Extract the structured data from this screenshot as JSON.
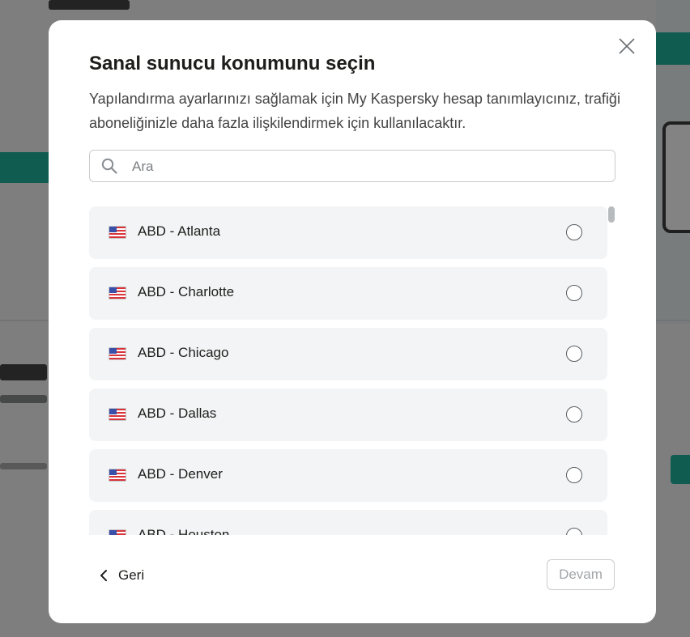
{
  "dialog": {
    "title": "Sanal sunucu konumunu seçin",
    "subtitle": "Yapılandırma ayarlarınızı sağlamak için My Kaspersky hesap tanımlayıcınız, trafiği aboneliğinizle daha fazla ilişkilendirmek için kullanılacaktır.",
    "close_icon": "close-icon"
  },
  "search": {
    "placeholder": "Ara",
    "value": "",
    "icon": "search-icon"
  },
  "locations": [
    {
      "label": "ABD - Atlanta",
      "flag": "us-flag-icon",
      "selected": false
    },
    {
      "label": "ABD - Charlotte",
      "flag": "us-flag-icon",
      "selected": false
    },
    {
      "label": "ABD - Chicago",
      "flag": "us-flag-icon",
      "selected": false
    },
    {
      "label": "ABD - Dallas",
      "flag": "us-flag-icon",
      "selected": false
    },
    {
      "label": "ABD - Denver",
      "flag": "us-flag-icon",
      "selected": false
    },
    {
      "label": "ABD - Houston",
      "flag": "us-flag-icon",
      "selected": false
    }
  ],
  "footer": {
    "back_label": "Geri",
    "back_icon": "chevron-left-icon",
    "next_label": "Devam",
    "next_enabled": false
  },
  "colors": {
    "accent": "#00a88e",
    "item_bg": "#f3f4f5",
    "disabled_text": "#a2a5a8"
  }
}
